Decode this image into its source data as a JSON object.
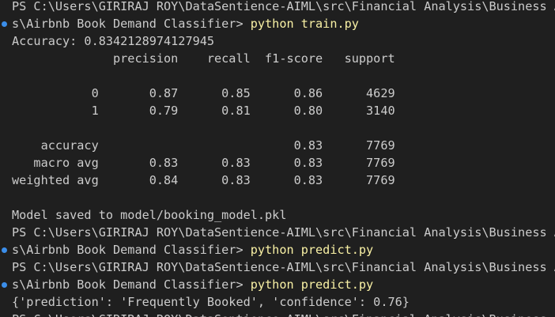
{
  "terminal": {
    "lines": {
      "l0": "PS C:\\Users\\GIRIRAJ ROY\\DataSentience-AIML\\src\\Financial Analysis\\Business An",
      "l1_prefix": "s\\Airbnb Book Demand Classifier> ",
      "l1_cmd": "python train.py",
      "l2": "Accuracy: 0.8342128974127945",
      "l3": "              precision    recall  f1-score   support",
      "l5": "           0       0.87      0.85      0.86      4629",
      "l6": "           1       0.79      0.81      0.80      3140",
      "l8": "    accuracy                           0.83      7769",
      "l9": "   macro avg       0.83      0.83      0.83      7769",
      "l10": "weighted avg       0.84      0.83      0.83      7769",
      "l12": "Model saved to model/booking_model.pkl",
      "l13": "PS C:\\Users\\GIRIRAJ ROY\\DataSentience-AIML\\src\\Financial Analysis\\Business An",
      "l14_prefix": "s\\Airbnb Book Demand Classifier> ",
      "l14_cmd": "python predict.py",
      "l15": "PS C:\\Users\\GIRIRAJ ROY\\DataSentience-AIML\\src\\Financial Analysis\\Business An",
      "l16_prefix": "s\\Airbnb Book Demand Classifier> ",
      "l16_cmd": "python predict.py",
      "l17": "{'prediction': 'Frequently Booked', 'confidence': 0.76}",
      "l18": "PS C:\\Users\\GIRIRAJ ROY\\DataSentience-AIML\\src\\Financial Analysis\\Business An"
    },
    "colors": {
      "background": "#1f1f1f",
      "text": "#cccccc",
      "command": "#f9f1a5",
      "decoration_dot": "#3b8eea"
    }
  }
}
